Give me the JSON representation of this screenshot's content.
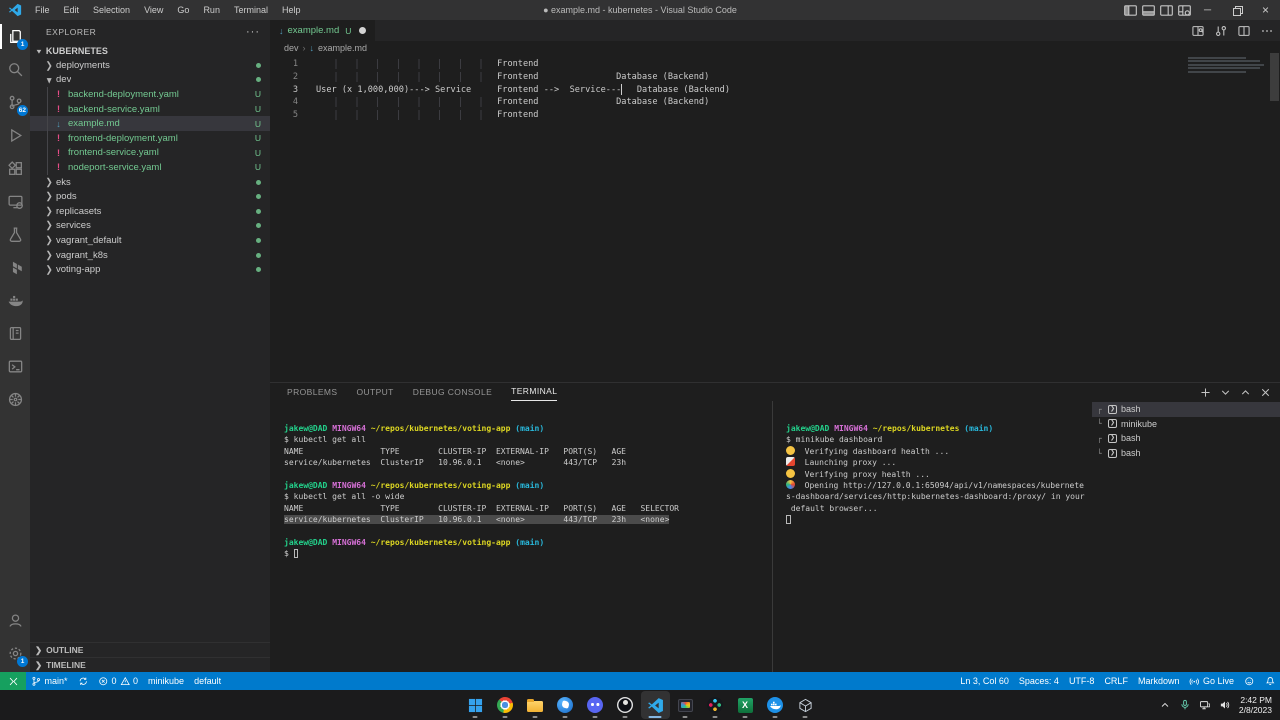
{
  "colors": {
    "statusbar_blue": "#007acc",
    "remote_green": "#16a05f",
    "untracked_green": "#73c991",
    "yaml_icon_pink": "#e64c87",
    "markdown_icon_blue": "#519aba",
    "badge_blue": "#0078d4",
    "prompt_green": "#23d18b",
    "prompt_magenta": "#d670d6",
    "prompt_yellow": "#dcd622",
    "prompt_cyan": "#29b8db"
  },
  "title_bar": {
    "logo_icon": "vscode-logo",
    "menus": [
      "File",
      "Edit",
      "Selection",
      "View",
      "Go",
      "Run",
      "Terminal",
      "Help"
    ],
    "title": "● example.md - kubernetes - Visual Studio Code",
    "layout_icons": [
      "layout-sidebar-icon",
      "layout-panel-icon",
      "layout-secondary-sidebar-icon",
      "layout-customize-icon"
    ],
    "window_controls": [
      {
        "name": "minimize",
        "glyph": "─"
      },
      {
        "name": "restore",
        "glyph": "❐"
      },
      {
        "name": "close",
        "glyph": "×"
      }
    ]
  },
  "activity_bar": {
    "top": [
      {
        "name": "explorer",
        "badge": "1",
        "active": true
      },
      {
        "name": "search"
      },
      {
        "name": "source-control",
        "badge": "62"
      },
      {
        "name": "run-debug"
      },
      {
        "name": "extensions"
      },
      {
        "name": "remote-explorer"
      },
      {
        "name": "testing"
      },
      {
        "name": "terraform"
      },
      {
        "name": "docker"
      },
      {
        "name": "notebook"
      },
      {
        "name": "terminal"
      },
      {
        "name": "kubernetes"
      }
    ],
    "bottom": [
      {
        "name": "account"
      },
      {
        "name": "settings",
        "badge": "1"
      }
    ]
  },
  "sidebar": {
    "header": "EXPLORER",
    "section": {
      "label": "KUBERNETES",
      "expanded": true
    },
    "tree": [
      {
        "label": "deployments",
        "kind": "folder",
        "depth": 0,
        "badge": "dot"
      },
      {
        "label": "dev",
        "kind": "folder",
        "depth": 0,
        "expanded": true,
        "badge": "dot"
      },
      {
        "label": "backend-deployment.yaml",
        "kind": "yaml",
        "depth": 1,
        "badge": "U"
      },
      {
        "label": "backend-service.yaml",
        "kind": "yaml",
        "depth": 1,
        "badge": "U"
      },
      {
        "label": "example.md",
        "kind": "md",
        "depth": 1,
        "badge": "U",
        "selected": true
      },
      {
        "label": "frontend-deployment.yaml",
        "kind": "yaml",
        "depth": 1,
        "badge": "U"
      },
      {
        "label": "frontend-service.yaml",
        "kind": "yaml",
        "depth": 1,
        "badge": "U"
      },
      {
        "label": "nodeport-service.yaml",
        "kind": "yaml",
        "depth": 1,
        "badge": "U"
      },
      {
        "label": "eks",
        "kind": "folder",
        "depth": 0,
        "badge": "dot"
      },
      {
        "label": "pods",
        "kind": "folder",
        "depth": 0,
        "badge": "dot"
      },
      {
        "label": "replicasets",
        "kind": "folder",
        "depth": 0,
        "badge": "dot"
      },
      {
        "label": "services",
        "kind": "folder",
        "depth": 0,
        "badge": "dot"
      },
      {
        "label": "vagrant_default",
        "kind": "folder",
        "depth": 0,
        "badge": "dot"
      },
      {
        "label": "vagrant_k8s",
        "kind": "folder",
        "depth": 0,
        "badge": "dot"
      },
      {
        "label": "voting-app",
        "kind": "folder",
        "depth": 0,
        "badge": "dot"
      }
    ],
    "bottom_sections": [
      {
        "label": "OUTLINE"
      },
      {
        "label": "TIMELINE"
      }
    ]
  },
  "editor": {
    "tab": {
      "icon": "markdown",
      "name": "example.md",
      "git_badge": "U",
      "dirty": true
    },
    "actions": [
      "markdown-preview-icon",
      "open-changes-icon",
      "split-editor-icon",
      "more-actions-icon"
    ],
    "breadcrumb": {
      "folder": "dev",
      "separator": "›",
      "file": "example.md",
      "file_icon": "markdown"
    },
    "cursor": {
      "line": 3,
      "col": 60
    },
    "lines": [
      {
        "num": "1",
        "segs": [
          {
            "p": 35,
            "g": true
          },
          {
            "t": "Frontend"
          }
        ]
      },
      {
        "num": "2",
        "segs": [
          {
            "p": 35,
            "g": true
          },
          {
            "t": "Frontend"
          },
          {
            "p": 15
          },
          {
            "t": "Database (Backend)"
          }
        ]
      },
      {
        "num": "3",
        "active": true,
        "segs": [
          {
            "t": "User (x 1,000,000)---> Service"
          },
          {
            "p": 5
          },
          {
            "t": "Frontend"
          },
          {
            "p": 1
          },
          {
            "t": "-->"
          },
          {
            "p": 2
          },
          {
            "t": "Service---"
          },
          {
            "cursor": true
          },
          {
            "p": 3
          },
          {
            "t": "Database (Backend)"
          }
        ]
      },
      {
        "num": "4",
        "segs": [
          {
            "p": 35,
            "g": true
          },
          {
            "t": "Frontend"
          },
          {
            "p": 15
          },
          {
            "t": "Database (Backend)"
          }
        ]
      },
      {
        "num": "5",
        "segs": [
          {
            "p": 35,
            "g": true
          },
          {
            "t": "Frontend"
          }
        ]
      }
    ]
  },
  "panel": {
    "tabs": [
      {
        "label": "PROBLEMS"
      },
      {
        "label": "OUTPUT"
      },
      {
        "label": "DEBUG CONSOLE"
      },
      {
        "label": "TERMINAL",
        "active": true
      }
    ],
    "actions": [
      "plus-icon",
      "chevron-down-icon",
      "chevron-up-icon",
      "close-icon"
    ],
    "terminal_left": {
      "lines": [
        {
          "segs": [
            {
              "t": "jakew@DAD",
              "c": "green"
            },
            {
              "p": 1
            },
            {
              "t": "MINGW64",
              "c": "magenta"
            },
            {
              "p": 1
            },
            {
              "t": "~/repos/kubernetes/voting-app",
              "c": "yellow"
            },
            {
              "p": 1
            },
            {
              "t": "(main)",
              "c": "cyan"
            }
          ]
        },
        {
          "segs": [
            {
              "t": "$ kubectl get all",
              "c": "fg"
            }
          ]
        },
        {
          "segs": [
            {
              "t": "NAME",
              "c": "fg"
            },
            {
              "p": 16
            },
            {
              "t": "TYPE",
              "c": "fg"
            },
            {
              "p": 8
            },
            {
              "t": "CLUSTER-IP",
              "c": "fg"
            },
            {
              "p": 2
            },
            {
              "t": "EXTERNAL-IP",
              "c": "fg"
            },
            {
              "p": 3
            },
            {
              "t": "PORT(S)",
              "c": "fg"
            },
            {
              "p": 3
            },
            {
              "t": "AGE",
              "c": "fg"
            }
          ]
        },
        {
          "segs": [
            {
              "t": "service/kubernetes",
              "c": "fg"
            },
            {
              "p": 2
            },
            {
              "t": "ClusterIP",
              "c": "fg"
            },
            {
              "p": 3
            },
            {
              "t": "10.96.0.1",
              "c": "fg"
            },
            {
              "p": 3
            },
            {
              "t": "<none>",
              "c": "fg"
            },
            {
              "p": 8
            },
            {
              "t": "443/TCP",
              "c": "fg"
            },
            {
              "p": 3
            },
            {
              "t": "23h",
              "c": "fg"
            }
          ]
        },
        {
          "segs": []
        },
        {
          "segs": [
            {
              "t": "jakew@DAD",
              "c": "green"
            },
            {
              "p": 1
            },
            {
              "t": "MINGW64",
              "c": "magenta"
            },
            {
              "p": 1
            },
            {
              "t": "~/repos/kubernetes/voting-app",
              "c": "yellow"
            },
            {
              "p": 1
            },
            {
              "t": "(main)",
              "c": "cyan"
            }
          ]
        },
        {
          "segs": [
            {
              "t": "$ kubectl get all -o wide",
              "c": "fg"
            }
          ]
        },
        {
          "segs": [
            {
              "t": "NAME",
              "c": "fg"
            },
            {
              "p": 16
            },
            {
              "t": "TYPE",
              "c": "fg"
            },
            {
              "p": 8
            },
            {
              "t": "CLUSTER-IP",
              "c": "fg"
            },
            {
              "p": 2
            },
            {
              "t": "EXTERNAL-IP",
              "c": "fg"
            },
            {
              "p": 3
            },
            {
              "t": "PORT(S)",
              "c": "fg"
            },
            {
              "p": 3
            },
            {
              "t": "AGE",
              "c": "fg"
            },
            {
              "p": 3
            },
            {
              "t": "SELECTOR",
              "c": "fg"
            }
          ]
        },
        {
          "selected": true,
          "segs": [
            {
              "t": "service/kubernetes",
              "c": "fg"
            },
            {
              "p": 2
            },
            {
              "t": "ClusterIP",
              "c": "fg"
            },
            {
              "p": 3
            },
            {
              "t": "10.96.0.1",
              "c": "fg"
            },
            {
              "p": 3
            },
            {
              "t": "<none>",
              "c": "fg"
            },
            {
              "p": 8
            },
            {
              "t": "443/TCP",
              "c": "fg"
            },
            {
              "p": 3
            },
            {
              "t": "23h",
              "c": "fg"
            },
            {
              "p": 3
            },
            {
              "t": "<none>",
              "c": "fg"
            }
          ]
        },
        {
          "segs": []
        },
        {
          "segs": [
            {
              "t": "jakew@DAD",
              "c": "green"
            },
            {
              "p": 1
            },
            {
              "t": "MINGW64",
              "c": "magenta"
            },
            {
              "p": 1
            },
            {
              "t": "~/repos/kubernetes/voting-app",
              "c": "yellow"
            },
            {
              "p": 1
            },
            {
              "t": "(main)",
              "c": "cyan"
            }
          ]
        },
        {
          "segs": [
            {
              "t": "$ ",
              "c": "fg"
            },
            {
              "cursor": true
            }
          ]
        }
      ]
    },
    "terminal_right": {
      "lines": [
        {
          "segs": [
            {
              "t": "jakew@DAD",
              "c": "green"
            },
            {
              "p": 1
            },
            {
              "t": "MINGW64",
              "c": "magenta"
            },
            {
              "p": 1
            },
            {
              "t": "~/repos/kubernetes",
              "c": "yellow"
            },
            {
              "p": 1
            },
            {
              "t": "(main)",
              "c": "cyan"
            }
          ]
        },
        {
          "segs": [
            {
              "t": "$ minikube dashboard",
              "c": "fg"
            }
          ]
        },
        {
          "segs": [
            {
              "icon": "thinking-face"
            },
            {
              "p": 2
            },
            {
              "t": "Verifying dashboard health ...",
              "c": "fg"
            }
          ]
        },
        {
          "segs": [
            {
              "icon": "rocket"
            },
            {
              "p": 2
            },
            {
              "t": "Launching proxy ...",
              "c": "fg"
            }
          ]
        },
        {
          "segs": [
            {
              "icon": "thinking-face"
            },
            {
              "p": 2
            },
            {
              "t": "Verifying proxy health ...",
              "c": "fg"
            }
          ]
        },
        {
          "segs": [
            {
              "icon": "party-popper"
            },
            {
              "p": 2
            },
            {
              "t": "Opening http://127.0.0.1:65094/api/v1/namespaces/kubernete",
              "c": "fg"
            }
          ]
        },
        {
          "segs": [
            {
              "t": "s-dashboard/services/http:kubernetes-dashboard:/proxy/ in your",
              "c": "fg"
            }
          ]
        },
        {
          "segs": [
            {
              "t": " default browser...",
              "c": "fg"
            }
          ]
        },
        {
          "segs": [
            {
              "cursor": true
            }
          ]
        }
      ]
    },
    "terminal_tabs": [
      {
        "tree": "┌",
        "icon": "terminal",
        "label": "bash",
        "selected": true
      },
      {
        "tree": "└",
        "icon": "terminal",
        "label": "minikube"
      },
      {
        "tree": "┌",
        "icon": "terminal",
        "label": "bash"
      },
      {
        "tree": "└",
        "icon": "terminal",
        "label": "bash"
      }
    ]
  },
  "status_bar": {
    "remote": {
      "icon": "remote"
    },
    "left": [
      {
        "icon": "git-branch",
        "text": "main*",
        "name": "git-branch"
      },
      {
        "icon": "sync",
        "text": "",
        "name": "sync"
      },
      {
        "icon": "error",
        "text": "0",
        "icon2": "warning",
        "text2": "0",
        "name": "problems"
      },
      {
        "text": "minikube",
        "name": "kubernetes-context"
      },
      {
        "text": "default",
        "name": "kubernetes-namespace"
      }
    ],
    "right": [
      {
        "text": "Ln 3, Col 60",
        "name": "cursor-position"
      },
      {
        "text": "Spaces: 4",
        "name": "indentation"
      },
      {
        "text": "UTF-8",
        "name": "encoding"
      },
      {
        "text": "CRLF",
        "name": "eol"
      },
      {
        "text": "Markdown",
        "name": "language-mode"
      },
      {
        "icon": "broadcast",
        "text": "Go Live",
        "name": "go-live"
      },
      {
        "icon": "feedback",
        "text": "",
        "name": "feedback"
      },
      {
        "icon": "bell",
        "text": "",
        "name": "notifications"
      }
    ]
  },
  "taskbar": {
    "items": [
      {
        "name": "start"
      },
      {
        "name": "chrome"
      },
      {
        "name": "file-explorer"
      },
      {
        "name": "game-app"
      },
      {
        "name": "discord"
      },
      {
        "name": "obs-studio"
      },
      {
        "name": "vscode",
        "active": true
      },
      {
        "name": "screen-tool"
      },
      {
        "name": "slack"
      },
      {
        "name": "excel"
      },
      {
        "name": "docker"
      },
      {
        "name": "3d-viewer"
      }
    ],
    "tray": {
      "icons": [
        "chevron-up",
        "microphone",
        "network",
        "volume"
      ],
      "time": "2:42 PM",
      "date": "2/8/2023"
    }
  }
}
